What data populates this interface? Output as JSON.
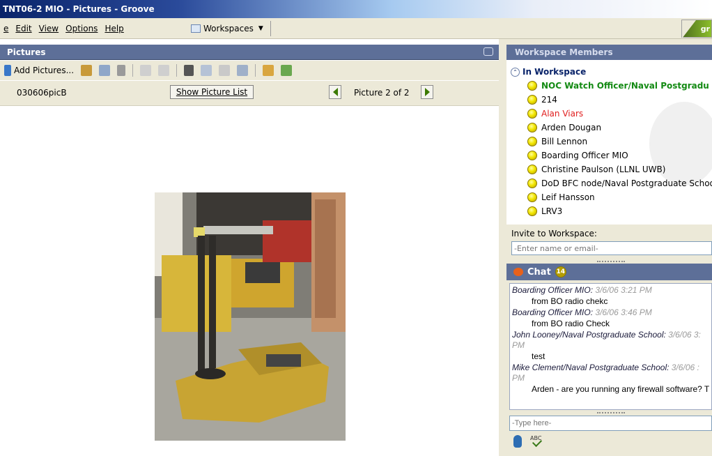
{
  "window": {
    "title": "TNT06-2 MIO - Pictures - Groove"
  },
  "menu": {
    "items": [
      "e",
      "Edit",
      "View",
      "Options",
      "Help"
    ],
    "workspaces_label": "Workspaces",
    "logo_text": "gr"
  },
  "pictures": {
    "header": "Pictures",
    "add_label": "Add Pictures...",
    "picture_name": "030606picB",
    "show_list_label": "Show Picture List",
    "count_label": "Picture 2 of 2"
  },
  "members": {
    "header": "Workspace Members",
    "group_label": "In Workspace",
    "list": [
      "NOC Watch Officer/Naval Postgradu",
      "214",
      "Alan Viars",
      "Arden Dougan",
      "Bill Lennon",
      "Boarding Officer MIO",
      "Christine Paulson (LLNL UWB)",
      "DoD BFC node/Naval Postgraduate School",
      "Leif Hansson",
      "LRV3"
    ]
  },
  "invite": {
    "label": "Invite to Workspace:",
    "placeholder": "-Enter name or email-"
  },
  "chat": {
    "header": "Chat",
    "unread_count": "14",
    "messages": [
      {
        "author": "Boarding Officer MIO:",
        "time": "3/6/06 3:21 PM",
        "body": "from BO radio chekc"
      },
      {
        "author": "Boarding Officer MIO:",
        "time": "3/6/06 3:46 PM",
        "body": "from BO radio Check"
      },
      {
        "author": "John Looney/Naval Postgraduate School:",
        "time": "3/6/06 3:",
        "wrap": "PM",
        "body": "test"
      },
      {
        "author": "Mike Clement/Naval Postgraduate School:",
        "time": "3/6/06 :",
        "wrap": "PM",
        "body": "Arden - are you running any firewall software? T"
      }
    ],
    "input_placeholder": "-Type here-"
  }
}
